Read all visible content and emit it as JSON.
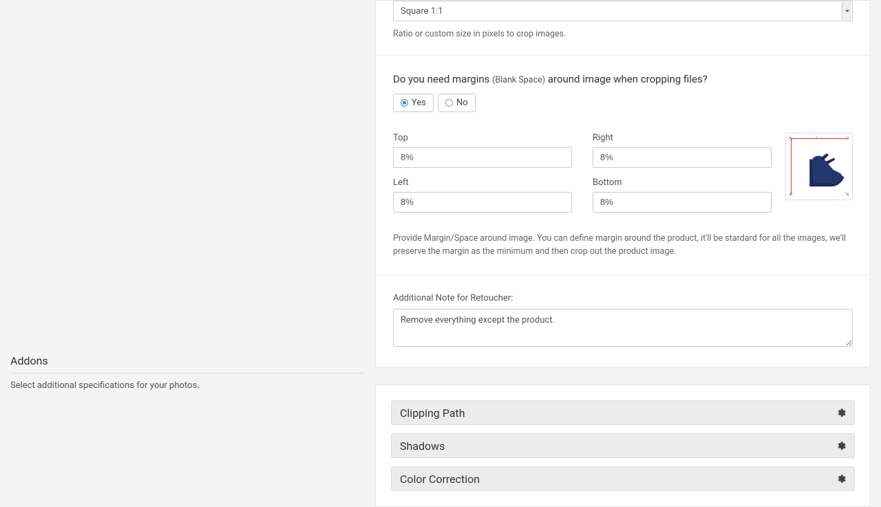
{
  "crop": {
    "ratio_selected": "Square 1:1",
    "ratio_help": "Ratio or custom size in pixels to crop images."
  },
  "margins": {
    "question_prefix": "Do you need margins ",
    "question_paren": "(Blank Space)",
    "question_suffix": " around image when cropping files?",
    "yes_label": "Yes",
    "no_label": "No",
    "selected": "yes",
    "top_label": "Top",
    "right_label": "Right",
    "left_label": "Left",
    "bottom_label": "Bottom",
    "top_value": "8%",
    "right_value": "8%",
    "left_value": "8%",
    "bottom_value": "8%",
    "help": "Provide Margin/Space around image. You can define margin around the product, it'll be stardard for all the images, we'll preserve the margin as the minimum and then crop out the product image."
  },
  "note": {
    "label": "Additional Note for Retoucher:",
    "value": "Remove everything except the product."
  },
  "addons": {
    "title": "Addons",
    "subtitle": "Select additional specifications for your photos.",
    "items": [
      {
        "label": "Clipping Path"
      },
      {
        "label": "Shadows"
      },
      {
        "label": "Color Correction"
      }
    ]
  }
}
